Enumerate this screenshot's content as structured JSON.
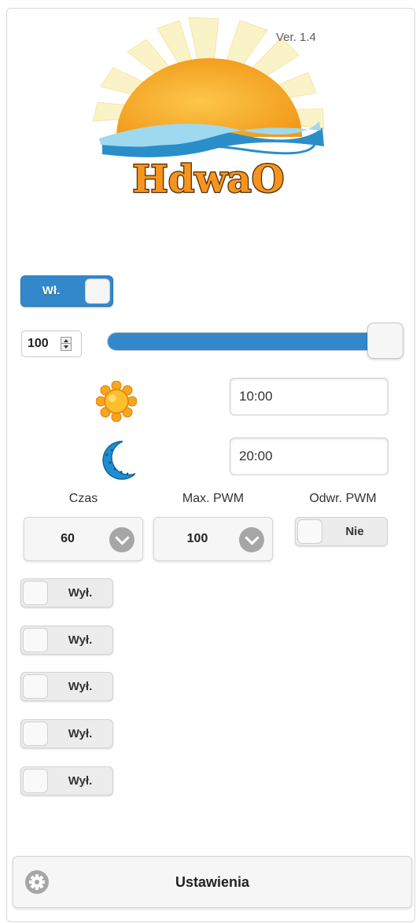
{
  "header": {
    "logo_text": "HdwaO",
    "version": "Ver. 1.4"
  },
  "power": {
    "label": "Wł.",
    "state": "on"
  },
  "pwm": {
    "value": "100",
    "slider_fraction": 1.0
  },
  "schedule": {
    "sunrise_icon": "sun-icon",
    "sunrise_time": "10:00",
    "sunset_icon": "moon-icon",
    "sunset_time": "20:00"
  },
  "settings_row": {
    "czas_header": "Czas",
    "czas_value": "60",
    "maxpwm_header": "Max. PWM",
    "maxpwm_value": "100",
    "invert_header": "Odwr. PWM",
    "invert_value": "Nie"
  },
  "channels": [
    {
      "label": "Wył."
    },
    {
      "label": "Wył."
    },
    {
      "label": "Wył."
    },
    {
      "label": "Wył."
    },
    {
      "label": "Wył."
    }
  ],
  "footer": {
    "settings_label": "Ustawienia",
    "settings_icon": "gear-icon"
  },
  "colors": {
    "accent": "#3388cc",
    "sun": "#f6a71c",
    "moon": "#1f8fd1"
  }
}
